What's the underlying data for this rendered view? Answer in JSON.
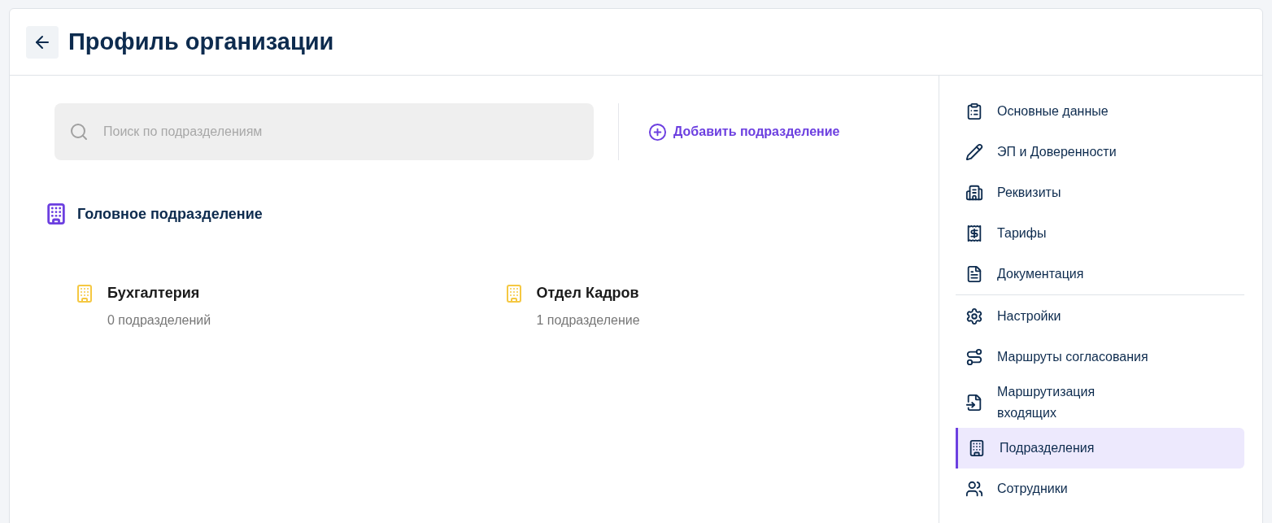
{
  "header": {
    "title": "Профиль организации"
  },
  "search": {
    "placeholder": "Поиск по подразделениям"
  },
  "add_button": {
    "label": "Добавить подразделение"
  },
  "head_department": {
    "title": "Головное подразделение"
  },
  "departments": [
    {
      "name": "Бухгалтерия",
      "count": "0 подразделений"
    },
    {
      "name": "Отдел Кадров",
      "count": "1 подразделение"
    }
  ],
  "sidebar": {
    "groups": [
      {
        "items": [
          {
            "label": "Основные данные",
            "selected": false
          },
          {
            "label": "ЭП и Доверенности",
            "selected": false
          },
          {
            "label": "Реквизиты",
            "selected": false
          },
          {
            "label": "Тарифы",
            "selected": false
          },
          {
            "label": "Документация",
            "selected": false
          }
        ]
      },
      {
        "items": [
          {
            "label": "Настройки",
            "selected": false
          },
          {
            "label": "Маршруты согласования",
            "selected": false
          },
          {
            "label": "Маршрутизация входящих",
            "selected": false
          },
          {
            "label": "Подразделения",
            "selected": true
          },
          {
            "label": "Сотрудники",
            "selected": false
          }
        ]
      }
    ]
  }
}
